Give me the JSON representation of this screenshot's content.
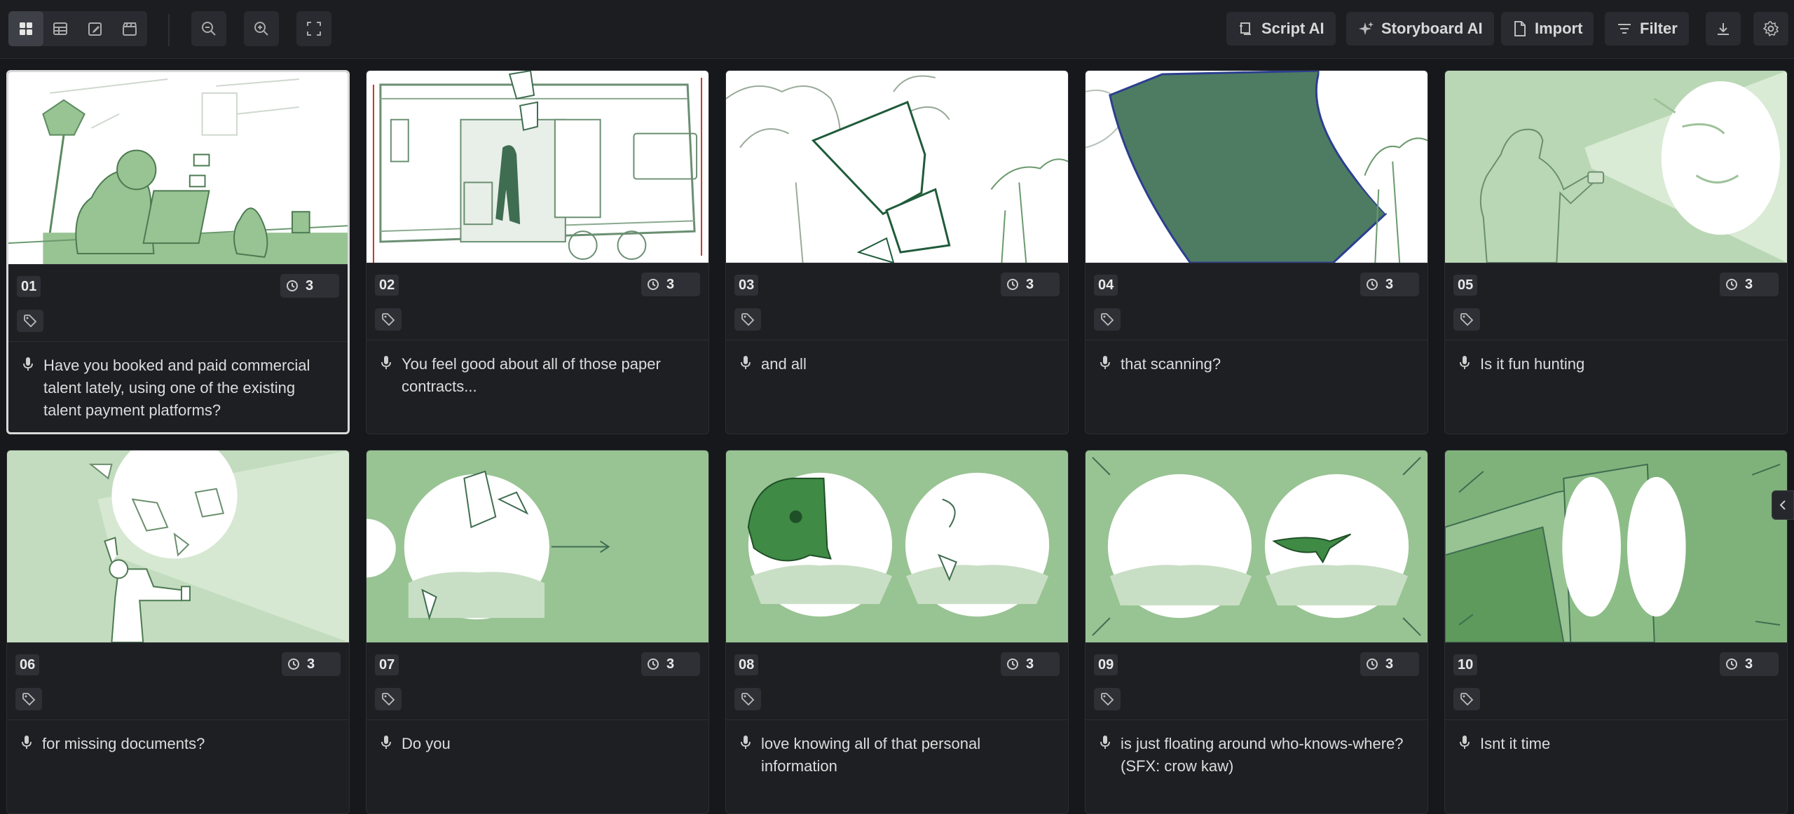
{
  "toolbar": {
    "view_modes": [
      {
        "name": "grid-view",
        "icon": "grid-icon",
        "active": true
      },
      {
        "name": "table-view",
        "icon": "table-icon",
        "active": false
      },
      {
        "name": "edit-view",
        "icon": "pencil-square-icon",
        "active": false
      },
      {
        "name": "clapper-view",
        "icon": "clapperboard-icon",
        "active": false
      }
    ],
    "zoom_out_icon": "zoom-out-icon",
    "zoom_in_icon": "zoom-in-icon",
    "fullscreen_icon": "fullscreen-icon",
    "script_ai_label": "Script AI",
    "storyboard_ai_label": "Storyboard AI",
    "import_label": "Import",
    "filter_label": "Filter",
    "download_icon": "download-icon",
    "settings_icon": "gear-icon"
  },
  "colors": {
    "background": "#17181b",
    "card": "#1e1f23",
    "accent_green": "#98c393",
    "dark_green": "#3f6d51"
  },
  "shots": [
    {
      "number": "01",
      "duration": "3",
      "dialogue": "Have you booked and paid commercial talent lately, using one of the existing talent payment platforms?",
      "selected": true
    },
    {
      "number": "02",
      "duration": "3",
      "dialogue": "You feel good about all of those paper contracts..."
    },
    {
      "number": "03",
      "duration": "3",
      "dialogue": "and all"
    },
    {
      "number": "04",
      "duration": "3",
      "dialogue": "that scanning?"
    },
    {
      "number": "05",
      "duration": "3",
      "dialogue": "Is it fun hunting"
    },
    {
      "number": "06",
      "duration": "3",
      "dialogue": "for missing documents?"
    },
    {
      "number": "07",
      "duration": "3",
      "dialogue": "Do you"
    },
    {
      "number": "08",
      "duration": "3",
      "dialogue": "love knowing all of that personal information"
    },
    {
      "number": "09",
      "duration": "3",
      "dialogue": "is just floating around who-knows-where? (SFX: crow kaw)"
    },
    {
      "number": "10",
      "duration": "3",
      "dialogue": "Isnt it time"
    }
  ]
}
